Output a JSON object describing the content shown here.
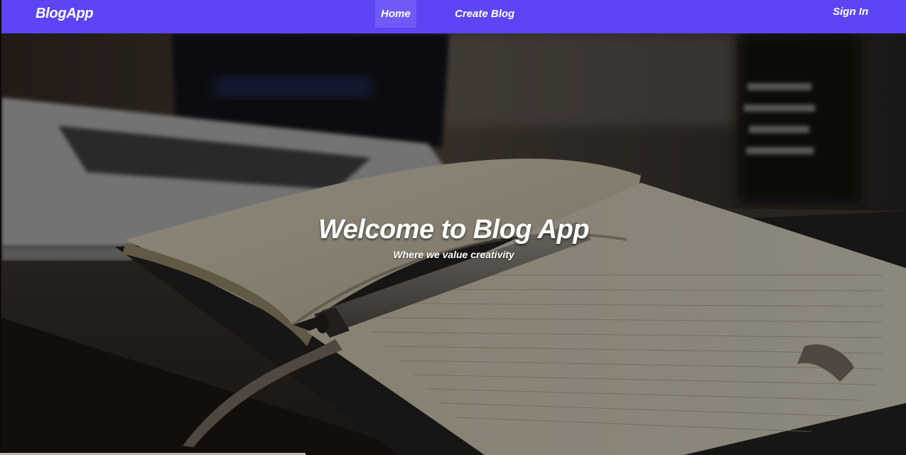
{
  "navbar": {
    "brand": "BlogApp",
    "links": [
      {
        "label": "Home",
        "active": true
      },
      {
        "label": "Create Blog",
        "active": false
      }
    ],
    "signin": "Sign In",
    "color": "#5b45f5",
    "active_color": "#6e5bf7"
  },
  "hero": {
    "title": "Welcome to Blog App",
    "subtitle": "Where we value creativity"
  }
}
